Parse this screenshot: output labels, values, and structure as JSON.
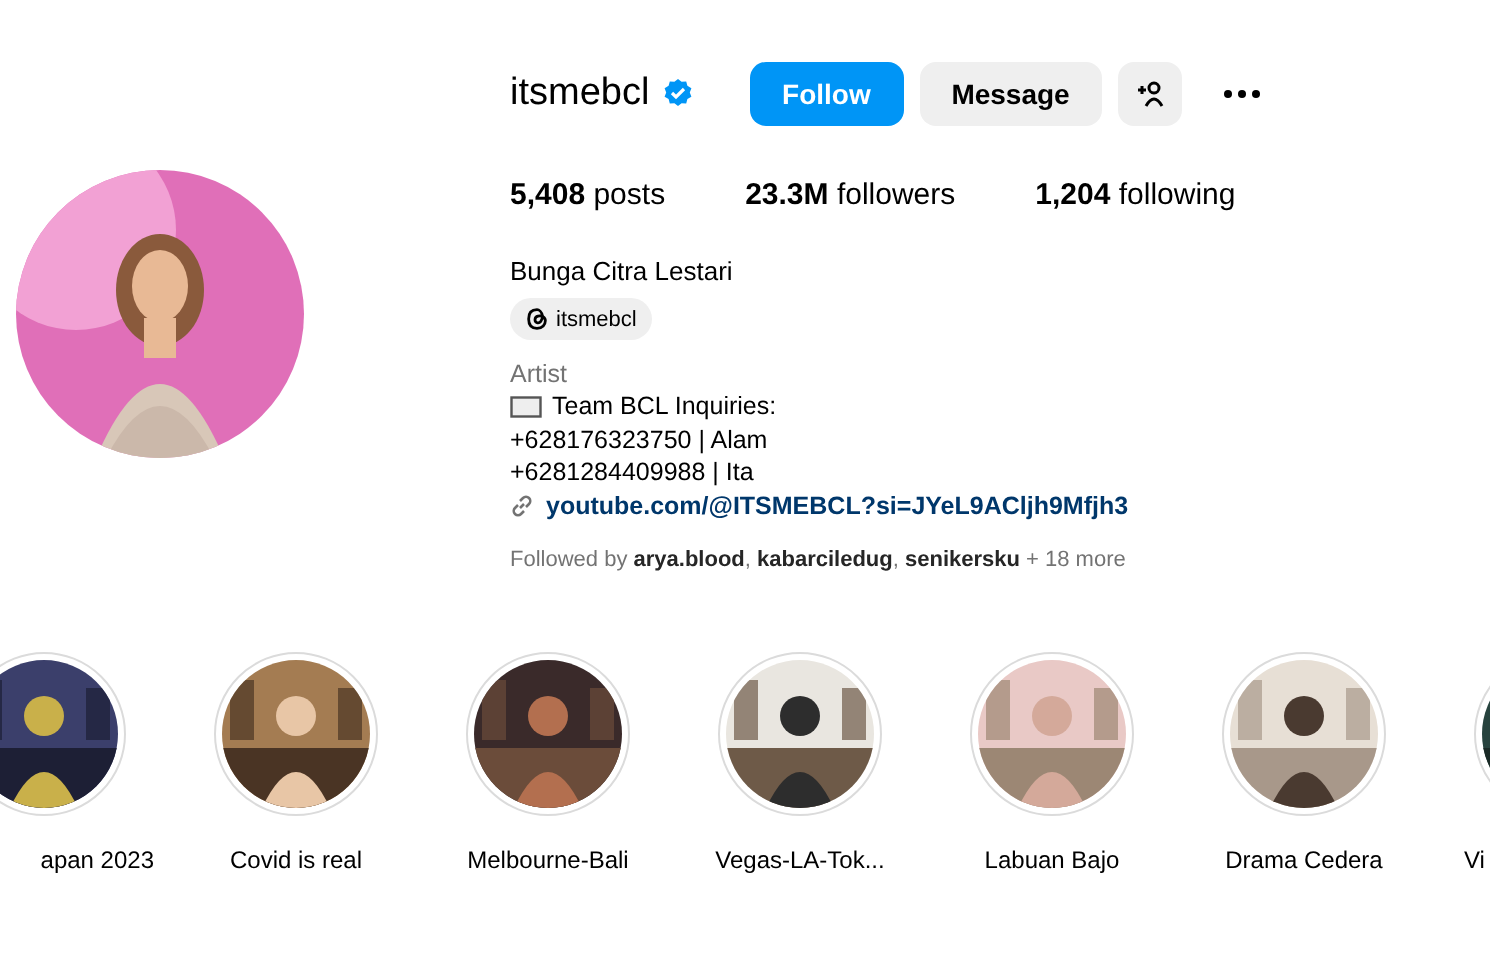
{
  "profile": {
    "username": "itsmebcl",
    "verified": true,
    "buttons": [
      {
        "kind": "primary",
        "label": "Follow"
      },
      {
        "kind": "secondary",
        "label": "Message"
      },
      {
        "kind": "icon"
      }
    ],
    "stats": [
      {
        "value": "5,408",
        "label": "posts"
      },
      {
        "value": "23.3M",
        "label": "followers"
      },
      {
        "value": "1,204",
        "label": "following"
      }
    ],
    "name": "Bunga Citra Lestari",
    "threads_handle": "itsmebcl",
    "category": "Artist",
    "bio_lines": [
      "Team BCL Inquiries:",
      "+628176323750 | Alam",
      "+6281284409988 | Ita"
    ],
    "link": "youtube.com/@ITSMEBCL?si=JYeL9ACljh9Mfjh3",
    "followed_by": "Followed by **arya.blood**, **kabarciledug**, **senikersku** + 18 more"
  },
  "highlights": [
    {
      "label": "apan 2023"
    },
    {
      "label": "Covid is real"
    },
    {
      "label": "Melbourne-Bali"
    },
    {
      "label": "Vegas-LA-Tok..."
    },
    {
      "label": "Labuan Bajo"
    },
    {
      "label": "Drama Cedera"
    },
    {
      "label": "Vi"
    }
  ]
}
